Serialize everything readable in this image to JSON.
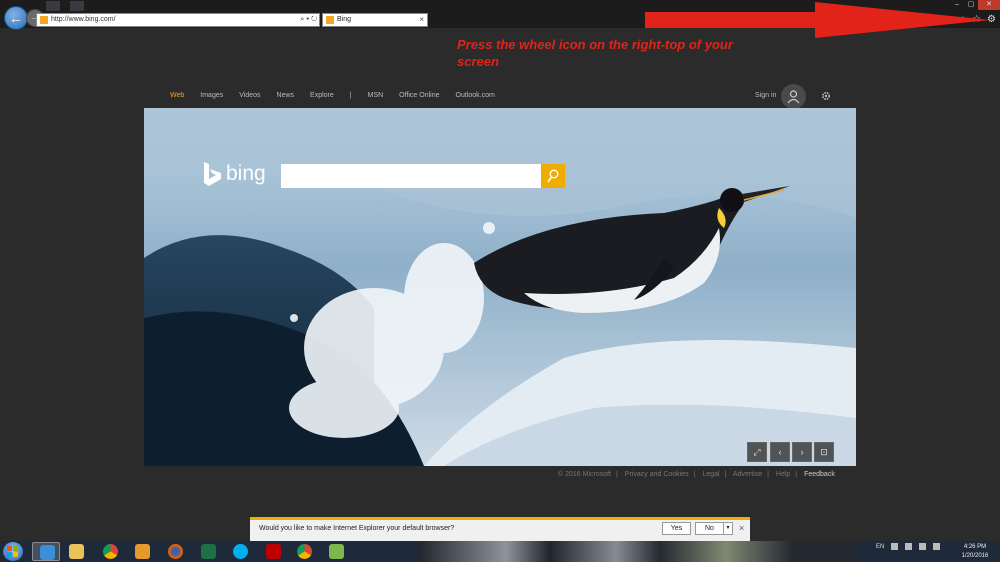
{
  "browser": {
    "url": "http://www.bing.com/",
    "address_icons": "⌕ ▾ ↻",
    "tab_title": "Bing",
    "tab_close": "×",
    "window_controls": [
      "‒",
      "▢",
      "✕"
    ],
    "toolbar_icons": [
      "⌂",
      "☆",
      "⚙"
    ]
  },
  "annotation": {
    "text": "Press the wheel icon on the right-top of your screen",
    "color": "#e2231a"
  },
  "bing": {
    "nav": [
      "Web",
      "Images",
      "Videos",
      "News",
      "Explore",
      "|",
      "MSN",
      "Office Online",
      "Outlook.com"
    ],
    "active_nav": "Web",
    "sign_in": "Sign in",
    "logo_text": "bing",
    "search_value": "",
    "accent": "#f0ac00",
    "hero_controls": [
      "⤢",
      "‹",
      "›",
      "⊡"
    ]
  },
  "footer": {
    "items": [
      "© 2016 Microsoft",
      "Privacy and Cookies",
      "Legal",
      "Advertise",
      "Help"
    ],
    "feedback": "Feedback"
  },
  "notification": {
    "text": "Would you like to make Internet Explorer your default browser?",
    "yes": "Yes",
    "no": "No",
    "dropdown": "▾",
    "close": "×"
  },
  "taskbar": {
    "apps": [
      "internet-explorer",
      "file-explorer",
      "chrome",
      "media-player",
      "firefox",
      "excel",
      "skype",
      "filezilla",
      "chrome-2",
      "notepad-app"
    ],
    "language": "EN",
    "time": "4:26 PM",
    "date": "1/20/2016"
  }
}
